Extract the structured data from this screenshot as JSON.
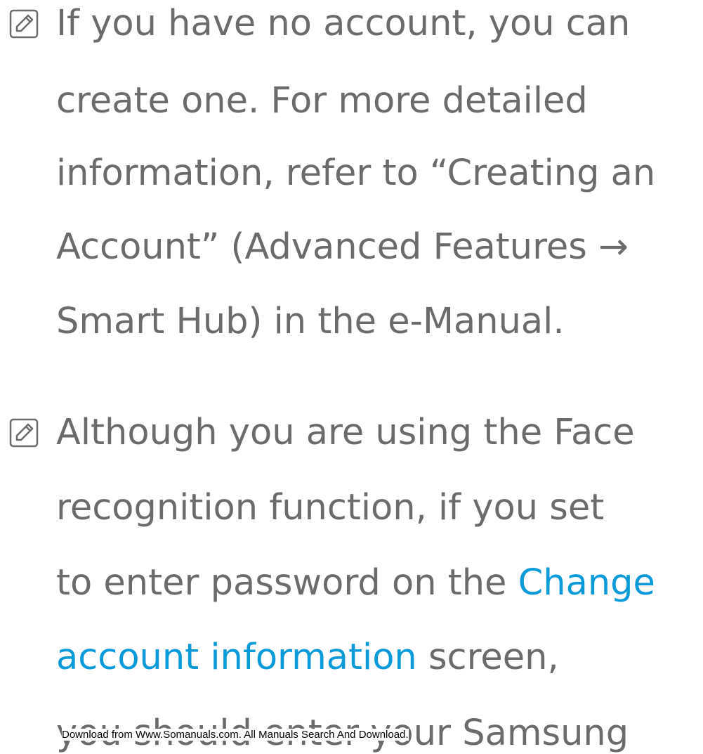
{
  "note1": {
    "icon": "note-icon",
    "lines": [
      "If you have no account, you can",
      "create one. For more detailed",
      "information, refer to “Creating an",
      "Account” (Advanced Features →",
      "Smart Hub) in the e-Manual."
    ]
  },
  "note2": {
    "icon": "note-icon",
    "line1": "Although you are using the Face",
    "line2": "recognition function, if you set",
    "line3_text": "to enter password on the ",
    "line3_link": "Change",
    "line4_link": "account information",
    "line4_text": " screen,",
    "line5": "you should enter your Samsung"
  },
  "footer": "Download from Www.Somanuals.com. All Manuals Search And Download.",
  "colors": {
    "text": "#6b6b6b",
    "highlight": "#0a9ad9"
  }
}
